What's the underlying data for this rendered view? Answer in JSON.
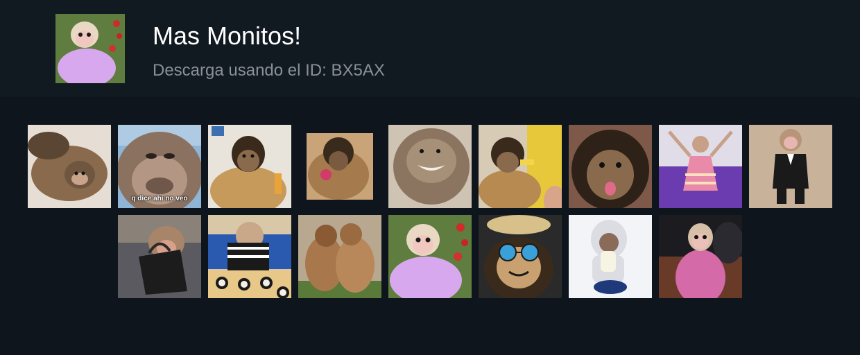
{
  "header": {
    "title": "Mas Monitos!",
    "subtitle": "Descarga usando el ID: BX5AX",
    "cover_icon": "monkey-in-lilac-towel-image"
  },
  "stickers": [
    {
      "icon": "monkey-lying-on-blanket-image",
      "caption": ""
    },
    {
      "icon": "monkey-closeup-face-image",
      "caption": "q dice ahí no veo"
    },
    {
      "icon": "capuchin-sitting-image",
      "caption": ""
    },
    {
      "icon": "capuchin-eating-image",
      "caption": ""
    },
    {
      "icon": "monkey-grinning-image",
      "caption": ""
    },
    {
      "icon": "capuchin-eating-fruit-image",
      "caption": ""
    },
    {
      "icon": "capuchin-tongue-out-image",
      "caption": ""
    },
    {
      "icon": "monkey-in-pink-dress-image",
      "caption": ""
    },
    {
      "icon": "monkey-in-tuxedo-image",
      "caption": ""
    },
    {
      "icon": "monkey-with-bag-image",
      "caption": ""
    },
    {
      "icon": "monkey-eating-sushi-image",
      "caption": ""
    },
    {
      "icon": "two-monkeys-kissing-image",
      "caption": ""
    },
    {
      "icon": "monkey-in-lilac-towel-image",
      "caption": ""
    },
    {
      "icon": "capuchin-sunglasses-hat-image",
      "caption": ""
    },
    {
      "icon": "monkey-in-hoodie-snow-image",
      "caption": ""
    },
    {
      "icon": "monkey-in-pink-blanket-image",
      "caption": ""
    }
  ]
}
